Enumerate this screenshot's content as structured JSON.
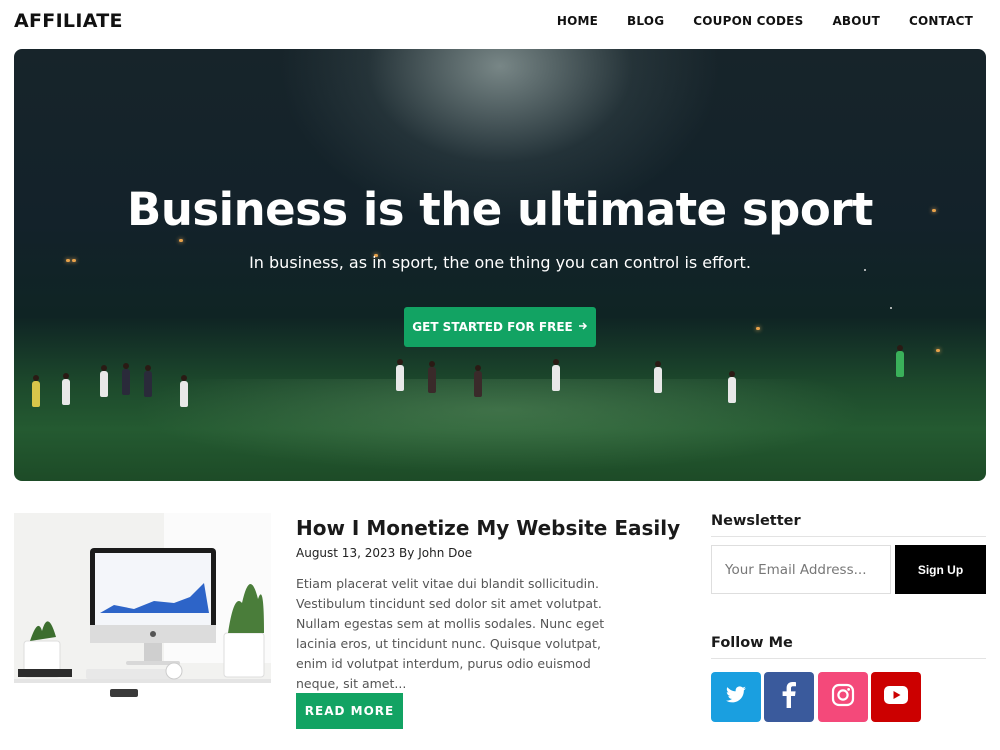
{
  "header": {
    "logo": "AFFILIATE",
    "nav": [
      "HOME",
      "BLOG",
      "COUPON CODES",
      "ABOUT",
      "CONTACT"
    ]
  },
  "hero": {
    "title": "Business is the ultimate sport",
    "subtitle": "In business, as in sport, the one thing you can control is effort.",
    "cta_label": "GET STARTED FOR FREE",
    "cta_icon": "arrow-right-icon",
    "image": "night-soccer-field"
  },
  "post": {
    "title": "How I Monetize My Website Easily",
    "meta": "August 13, 2023 By John Doe",
    "excerpt": "Etiam placerat velit vitae dui blandit sollicitudin. Vestibulum tincidunt sed dolor sit amet volutpat. Nullam egestas sem at mollis sodales. Nunc eget lacinia eros, ut tincidunt nunc. Quisque volutpat, enim id volutpat interdum, purus odio euismod neque, sit amet...",
    "read_more": "READ MORE",
    "image": "desktop-computer-workspace"
  },
  "sidebar": {
    "newsletter": {
      "heading": "Newsletter",
      "placeholder": "Your Email Address...",
      "button": "Sign Up"
    },
    "follow": {
      "heading": "Follow Me",
      "icons": [
        {
          "name": "twitter-icon",
          "color": "#1a9fe0"
        },
        {
          "name": "facebook-icon",
          "color": "#3a5a9c"
        },
        {
          "name": "instagram-icon",
          "color": "#f4497a"
        },
        {
          "name": "youtube-icon",
          "color": "#cc0000"
        }
      ]
    }
  },
  "colors": {
    "accent": "#12a363",
    "signup_bg": "#000000"
  }
}
